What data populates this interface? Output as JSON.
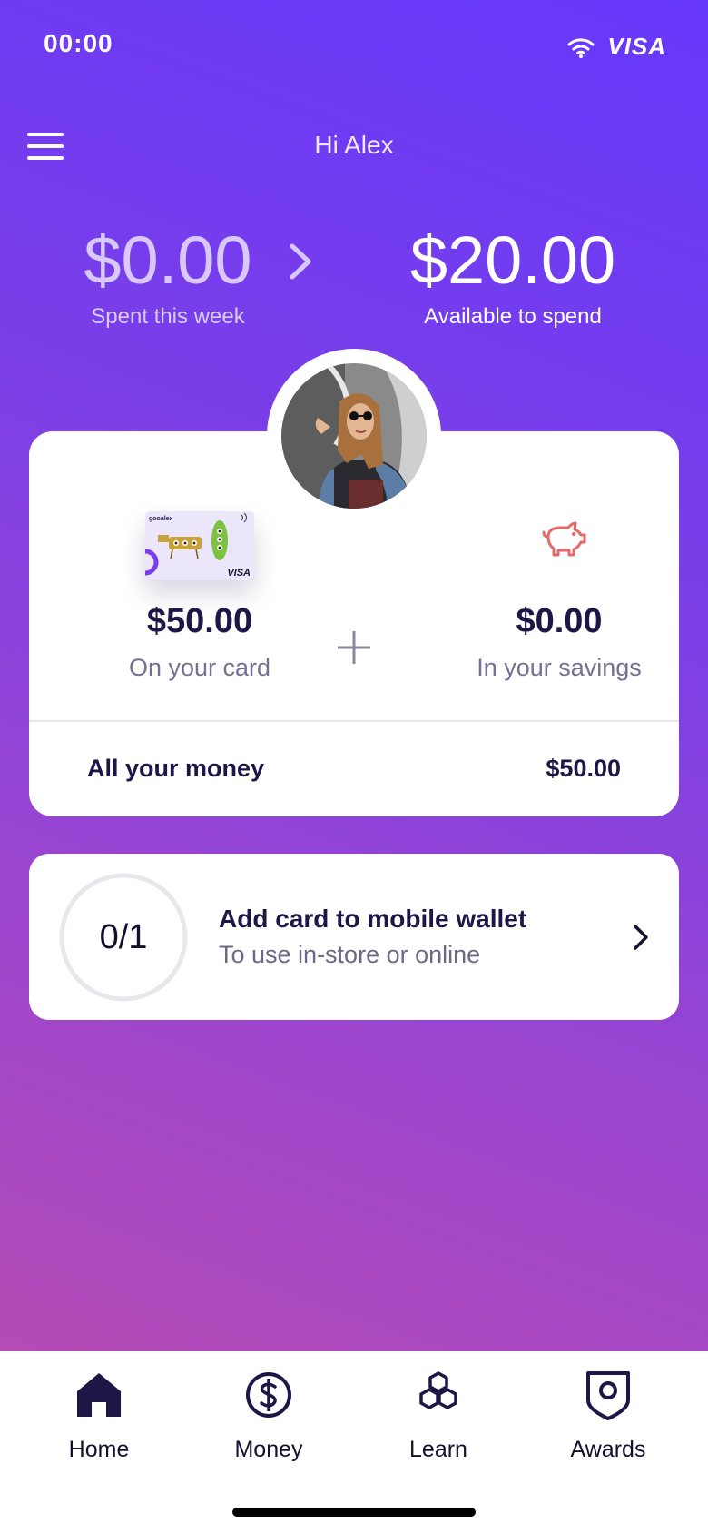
{
  "status_bar": {
    "time": "00:00",
    "wifi_icon": "wifi-icon",
    "network": "VISA"
  },
  "header": {
    "greeting": "Hi Alex",
    "menu_icon": "hamburger-menu-icon"
  },
  "summary": {
    "spent_amount": "$0.00",
    "spent_label": "Spent this week",
    "available_amount": "$20.00",
    "available_label": "Available to spend"
  },
  "balance": {
    "card": {
      "amount": "$50.00",
      "label": "On your card",
      "brand_text": "gooalex",
      "network": "VISA"
    },
    "savings": {
      "amount": "$0.00",
      "label": "In your savings",
      "icon": "piggy-bank-icon"
    },
    "total": {
      "label": "All your money",
      "value": "$50.00"
    }
  },
  "wallet_task": {
    "progress": "0/1",
    "progress_fraction": 0,
    "title": "Add card to mobile wallet",
    "subtitle": "To use in-store or online"
  },
  "tabs": [
    {
      "label": "Home",
      "icon": "home-icon",
      "active": true
    },
    {
      "label": "Money",
      "icon": "dollar-icon",
      "active": false
    },
    {
      "label": "Learn",
      "icon": "hexagons-icon",
      "active": false
    },
    {
      "label": "Awards",
      "icon": "shield-icon",
      "active": false
    }
  ],
  "colors": {
    "gradient_top": "#6638fb",
    "gradient_bottom": "#bc4ea8",
    "text_dark": "#1e1646",
    "text_muted": "#757194",
    "piggy": "#e56b6b"
  }
}
